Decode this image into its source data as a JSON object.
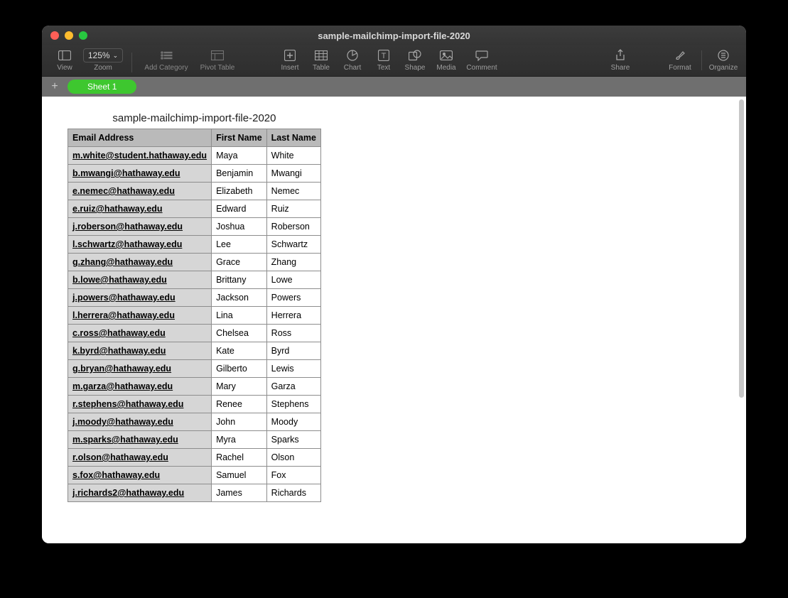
{
  "window": {
    "title": "sample-mailchimp-import-file-2020"
  },
  "traffic": {
    "close": "close",
    "min": "minimize",
    "max": "maximize"
  },
  "toolbar": {
    "view": "View",
    "zoom": "Zoom",
    "zoom_value": "125%",
    "add_category": "Add Category",
    "pivot_table": "Pivot Table",
    "insert": "Insert",
    "table": "Table",
    "chart": "Chart",
    "text": "Text",
    "shape": "Shape",
    "media": "Media",
    "comment": "Comment",
    "share": "Share",
    "format": "Format",
    "organize": "Organize"
  },
  "tabs": {
    "sheet1": "Sheet 1"
  },
  "table": {
    "title": "sample-mailchimp-import-file-2020",
    "headers": {
      "email": "Email Address",
      "first": "First Name",
      "last": "Last Name"
    },
    "rows": [
      {
        "email": "m.white@student.hathaway.edu",
        "first": "Maya",
        "last": "White"
      },
      {
        "email": "b.mwangi@hathaway.edu",
        "first": "Benjamin",
        "last": "Mwangi"
      },
      {
        "email": "e.nemec@hathaway.edu",
        "first": "Elizabeth",
        "last": "Nemec"
      },
      {
        "email": "e.ruiz@hathaway.edu",
        "first": "Edward",
        "last": "Ruiz"
      },
      {
        "email": "j.roberson@hathaway.edu",
        "first": "Joshua",
        "last": "Roberson"
      },
      {
        "email": "l.schwartz@hathaway.edu",
        "first": "Lee",
        "last": "Schwartz"
      },
      {
        "email": "g.zhang@hathaway.edu",
        "first": "Grace",
        "last": "Zhang"
      },
      {
        "email": "b.lowe@hathaway.edu",
        "first": "Brittany",
        "last": "Lowe"
      },
      {
        "email": "j.powers@hathaway.edu",
        "first": "Jackson",
        "last": "Powers"
      },
      {
        "email": "l.herrera@hathaway.edu",
        "first": "Lina",
        "last": "Herrera"
      },
      {
        "email": "c.ross@hathaway.edu",
        "first": "Chelsea",
        "last": "Ross"
      },
      {
        "email": "k.byrd@hathaway.edu",
        "first": "Kate",
        "last": "Byrd"
      },
      {
        "email": "g.bryan@hathaway.edu",
        "first": "Gilberto",
        "last": "Lewis"
      },
      {
        "email": "m.garza@hathaway.edu",
        "first": "Mary",
        "last": "Garza"
      },
      {
        "email": "r.stephens@hathaway.edu",
        "first": "Renee",
        "last": "Stephens"
      },
      {
        "email": "j.moody@hathaway.edu",
        "first": "John",
        "last": "Moody"
      },
      {
        "email": "m.sparks@hathaway.edu",
        "first": "Myra",
        "last": "Sparks"
      },
      {
        "email": "r.olson@hathaway.edu",
        "first": "Rachel",
        "last": "Olson"
      },
      {
        "email": "s.fox@hathaway.edu",
        "first": "Samuel",
        "last": "Fox"
      },
      {
        "email": "j.richards2@hathaway.edu",
        "first": "James",
        "last": "Richards"
      }
    ]
  }
}
